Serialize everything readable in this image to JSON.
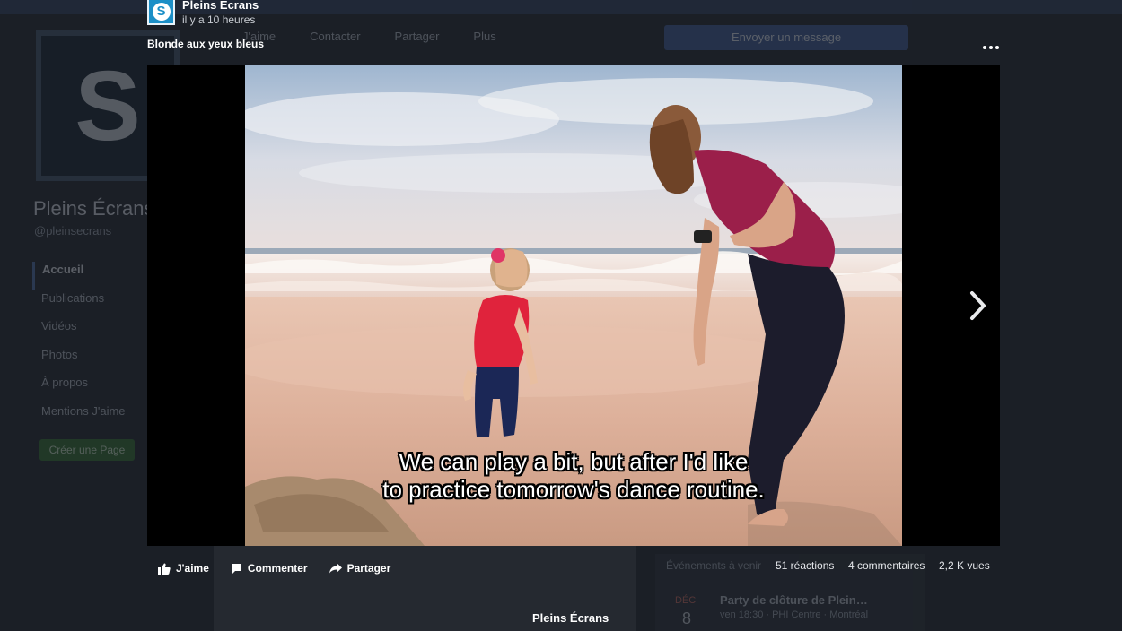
{
  "background": {
    "logo_letter": "S",
    "page_name": "Pleins Écrans",
    "page_handle": "@pleinsecrans",
    "nav": [
      "Accueil",
      "Publications",
      "Vidéos",
      "Photos",
      "À propos",
      "Mentions J'aime"
    ],
    "create_page": "Créer une Page",
    "actions": [
      "J'aime",
      "Contacter",
      "Partager",
      "Plus"
    ],
    "message_button": "Envoyer un message",
    "stats_label": "Événements à venir",
    "event": {
      "month": "DÉC",
      "day": "8",
      "title": "Party de clôture de Plein…",
      "subtitle": "ven 18:30 · PHI Centre · Montréal"
    }
  },
  "post": {
    "author": "Pleins Ecrans",
    "time": "il y a 10 heures",
    "caption": "Blonde aux yeux bleus",
    "avatar_letter": "S"
  },
  "video": {
    "subtitle_line1": "We can play a bit, but after I'd like",
    "subtitle_line2": "to practice tomorrow's dance routine."
  },
  "actions": {
    "like": "J'aime",
    "comment": "Commenter",
    "share": "Partager"
  },
  "stats": {
    "reactions": "51 réactions",
    "comments": "4 commentaires",
    "views": "2,2 K vues"
  },
  "bottom_label": "Pleins Écrans",
  "icons": [
    "thumbs-up-icon",
    "comment-icon",
    "share-icon",
    "more-icon",
    "chevron-right-icon"
  ],
  "colors": {
    "overlay_bg": "#1b1f26",
    "brand_blue": "#1c8fc7",
    "text": "#ffffff"
  }
}
